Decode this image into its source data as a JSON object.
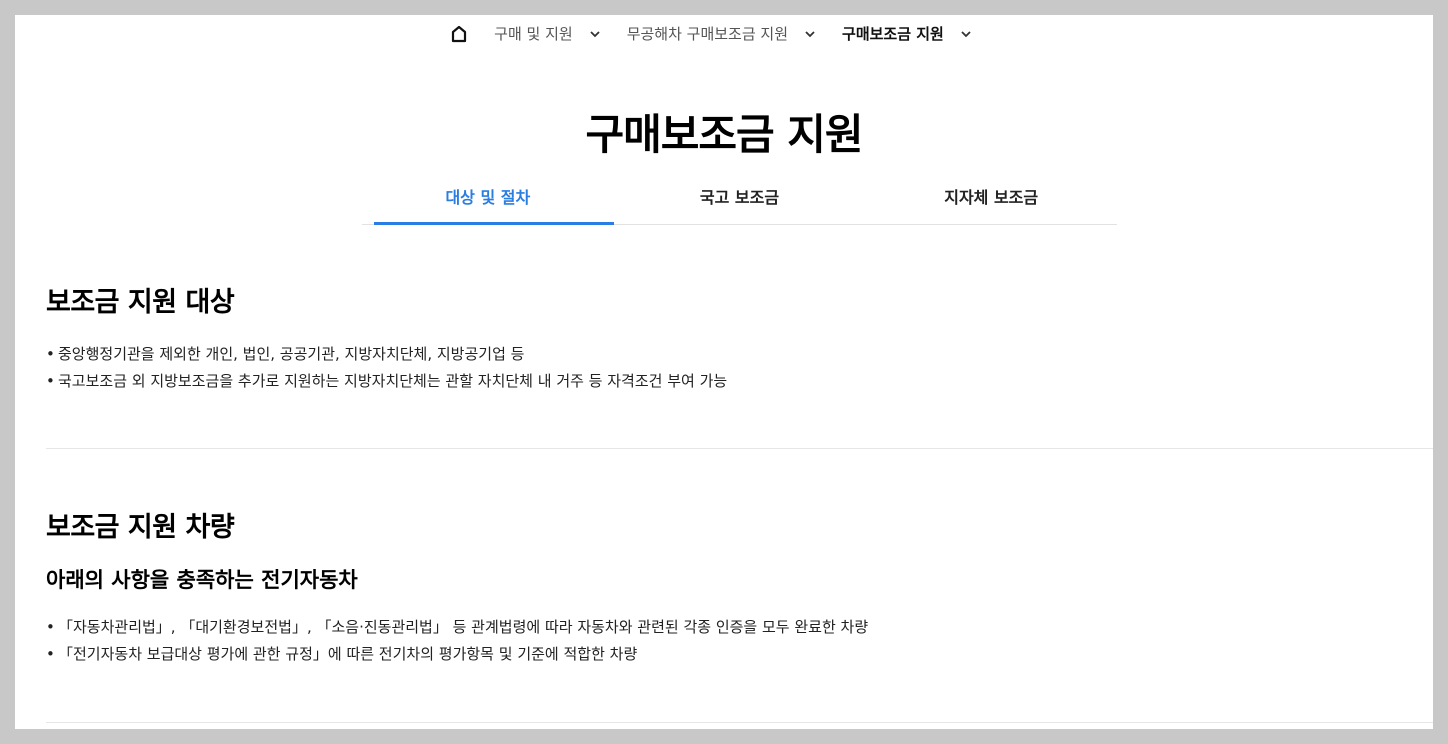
{
  "breadcrumb": {
    "items": [
      {
        "label": "구매 및 지원"
      },
      {
        "label": "무공해차 구매보조금 지원"
      },
      {
        "label": "구매보조금 지원"
      }
    ]
  },
  "page_title": "구매보조금 지원",
  "tabs": [
    {
      "label": "대상 및 절차",
      "active": true
    },
    {
      "label": "국고 보조금",
      "active": false
    },
    {
      "label": "지자체 보조금",
      "active": false
    }
  ],
  "section1": {
    "title": "보조금 지원 대상",
    "bullets": [
      "중앙행정기관을 제외한 개인, 법인, 공공기관, 지방자치단체, 지방공기업 등",
      "국고보조금 외 지방보조금을 추가로 지원하는 지방자치단체는 관할 자치단체 내 거주 등 자격조건 부여 가능"
    ]
  },
  "section2": {
    "title": "보조금 지원 차량",
    "subtitle": "아래의 사항을 충족하는 전기자동차",
    "bullets": [
      "「자동차관리법」, 「대기환경보전법」, 「소음·진동관리법」 등 관계법령에 따라 자동차와 관련된 각종 인증을 모두 완료한 차량",
      "「전기자동차 보급대상 평가에 관한 규정」에 따른 전기차의 평가항목 및 기준에 적합한 차량"
    ]
  },
  "colors": {
    "accent": "#2a7de1",
    "frame_bg": "#c8c8c8"
  },
  "icons": {
    "home": "home-icon",
    "chevron": "chevron-down-icon"
  }
}
